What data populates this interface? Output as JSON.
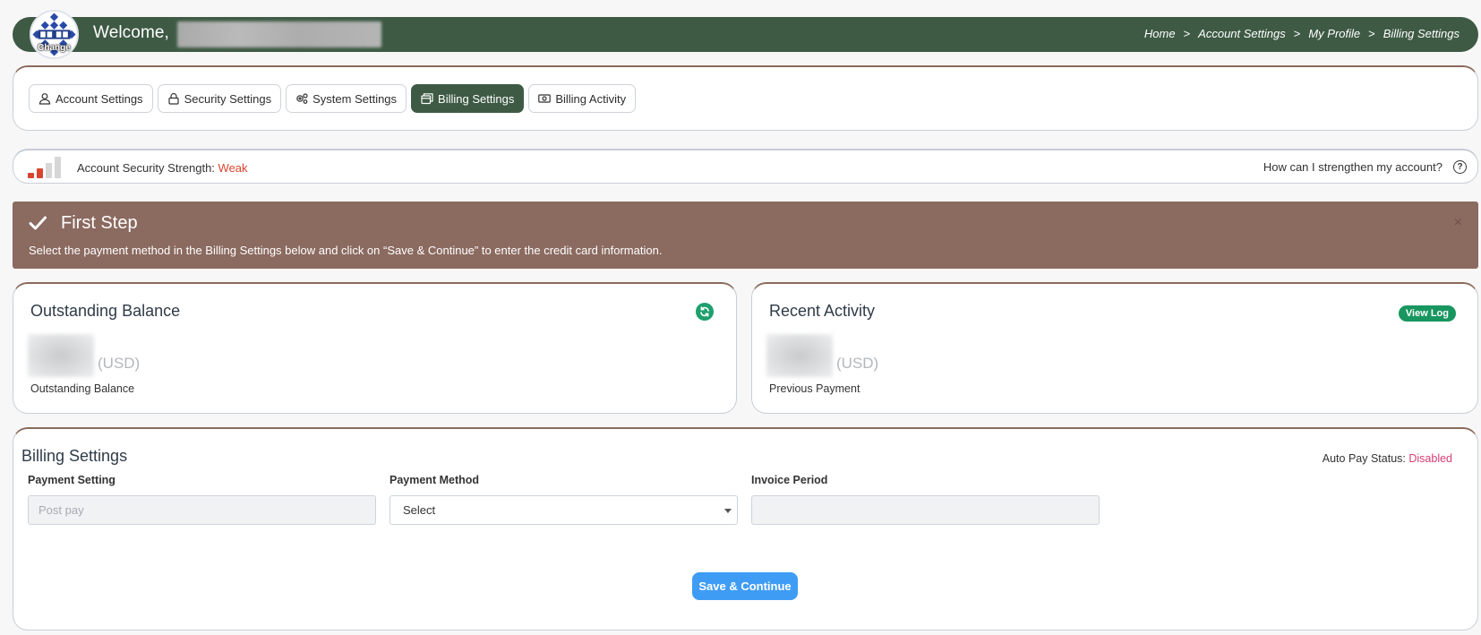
{
  "header": {
    "avatar_change_label": "Change",
    "welcome": "Welcome,",
    "breadcrumb": [
      "Home",
      "Account Settings",
      "My Profile",
      "Billing Settings"
    ],
    "breadcrumb_separator": ">"
  },
  "tabs": [
    {
      "label": "Account Settings",
      "icon": "user-icon",
      "active": false
    },
    {
      "label": "Security Settings",
      "icon": "lock-icon",
      "active": false
    },
    {
      "label": "System Settings",
      "icon": "gears-icon",
      "active": false
    },
    {
      "label": "Billing Settings",
      "icon": "cards-icon",
      "active": true
    },
    {
      "label": "Billing Activity",
      "icon": "money-icon",
      "active": false
    }
  ],
  "security": {
    "label": "Account Security Strength:",
    "value": "Weak",
    "help_text": "How can I strengthen my account?",
    "strength_level": 2,
    "strength_max": 4,
    "colors": {
      "weak": "#d9442e",
      "inactive": "#d6d6d6"
    }
  },
  "alert": {
    "title": "First Step",
    "message": "Select the payment method in the Billing Settings below and click on “Save & Continue” to enter the credit card information.",
    "close": "×"
  },
  "outstanding": {
    "title": "Outstanding Balance",
    "currency": "(USD)",
    "subtitle": "Outstanding Balance"
  },
  "recent": {
    "title": "Recent Activity",
    "button": "View Log",
    "currency": "(USD)",
    "subtitle": "Previous Payment"
  },
  "billing": {
    "title": "Billing Settings",
    "autopay_label": "Auto Pay Status:",
    "autopay_value": "Disabled",
    "payment_setting_label": "Payment Setting",
    "payment_setting_placeholder": "Post pay",
    "payment_method_label": "Payment Method",
    "payment_method_value": "Select",
    "invoice_period_label": "Invoice Period",
    "invoice_period_value": "",
    "save_button": "Save & Continue"
  },
  "colors": {
    "header_green": "#3e5a44",
    "alert_brown": "#8b6a60",
    "card_accent": "#8a6a5c",
    "primary_blue": "#3f9cf5",
    "success_green": "#18965f",
    "disabled_pink": "#d63d73"
  }
}
